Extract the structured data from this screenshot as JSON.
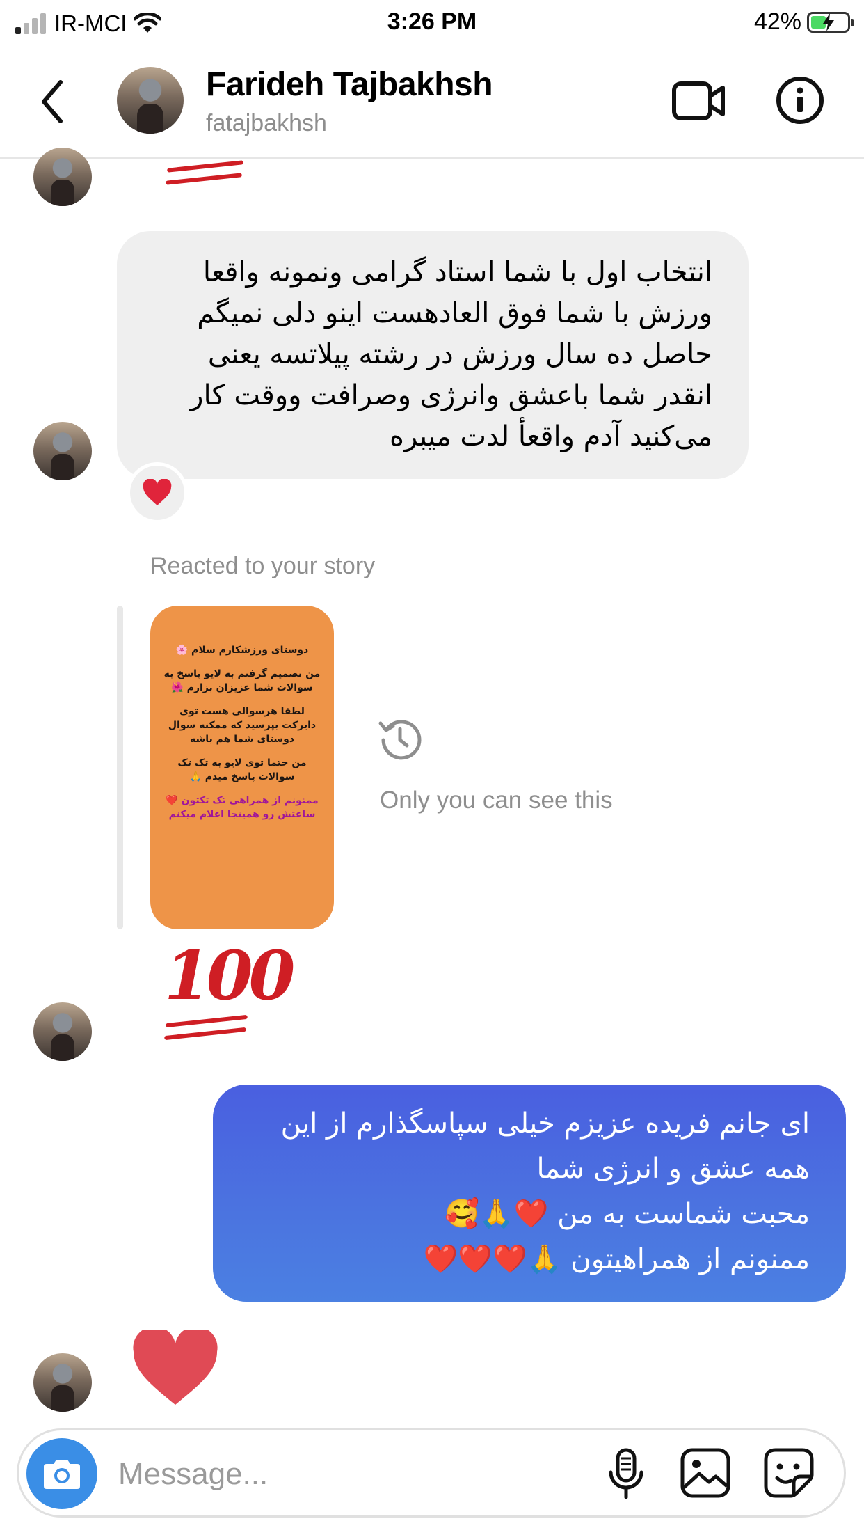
{
  "status_bar": {
    "carrier": "IR-MCI",
    "time": "3:26 PM",
    "battery_percent": "42%",
    "battery_level": 0.42
  },
  "header": {
    "name": "Farideh Tajbakhsh",
    "username": "fatajbakhsh",
    "icons": [
      "back-icon",
      "video-call-icon",
      "info-icon"
    ]
  },
  "messages": {
    "incoming_1": {
      "lines": [
        "انتخاب اول با شما استاد گرامی ونمونه واقعا",
        "ورزش با شما فوق العادهست اینو دلی نمیگم",
        "حاصل ده سال ورزش در رشته پیلاتسه یعنی",
        "انقدر شما باعشق وانرژی وصرافت ووقت کار",
        "می‌کنید آدم واقعأ لدت میبره"
      ],
      "reaction": "❤️"
    },
    "story_reply": {
      "caption": "Reacted to your story",
      "privacy_note": "Only you can see this",
      "story_text": [
        "دوستای ورزشکارم سلام 🌸",
        "من تصمیم گرفتم به لایو پاسخ به سوالات شما عزیزان بزارم 🌺",
        "لطفا هرسوالی هست توی دایرکت بپرسید که ممکنه سوال دوستای شما هم باشه",
        "من حتما توی لایو به تک تک سوالات پاسخ میدم 🙏",
        "ممنونم از همراهی تک تکتون ❤️ ساعتش رو همینجا اعلام میکنم"
      ],
      "story_emoji": "100"
    },
    "outgoing": {
      "lines": [
        "ای جانم فریده عزیزم خیلی سپاسگذارم از این",
        "همه عشق و انرژی شما",
        "محبت شماست به من ❤️🙏🥰",
        "ممنونم از همراهیتون 🙏❤️❤️❤️"
      ]
    },
    "last_incoming_icon": "heart-icon"
  },
  "composer": {
    "placeholder": "Message...",
    "icons": [
      "camera-icon",
      "microphone-icon",
      "gallery-icon",
      "sticker-icon"
    ]
  },
  "colors": {
    "outgoing_bubble": "#4b6ee0",
    "incoming_bubble": "#efefef",
    "story_bg": "#ee9448",
    "heart": "#e04a55",
    "camera_button": "#3a8ee6"
  }
}
